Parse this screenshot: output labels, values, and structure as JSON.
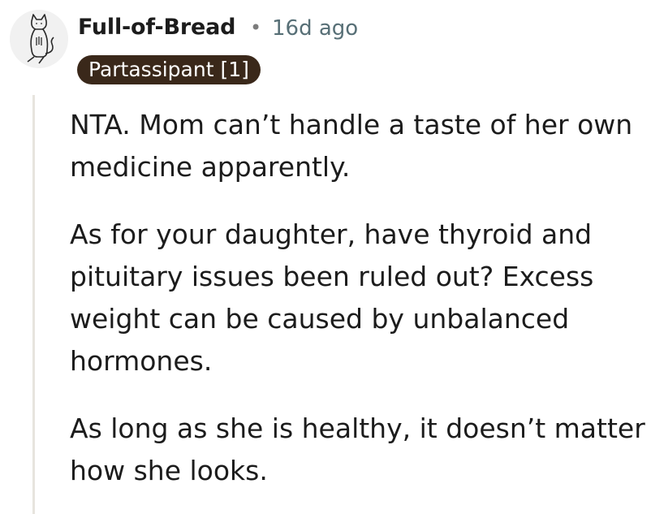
{
  "comment": {
    "author": "Full-of-Bread",
    "separator": "•",
    "timestamp": "16d ago",
    "flair": "Partassipant [1]",
    "avatar_icon": "cat-avatar-icon",
    "paragraphs": [
      "NTA. Mom can’t handle a taste of her own medicine apparently.",
      "As for your daughter, have thyroid and pituitary issues been ruled out? Excess weight can be caused by unbalanced hormones.",
      "As long as she is healthy, it doesn’t matter how she looks."
    ]
  },
  "colors": {
    "flair_bg": "#3a281a",
    "thread_line": "#e7e4de",
    "meta_text": "#576f76"
  }
}
